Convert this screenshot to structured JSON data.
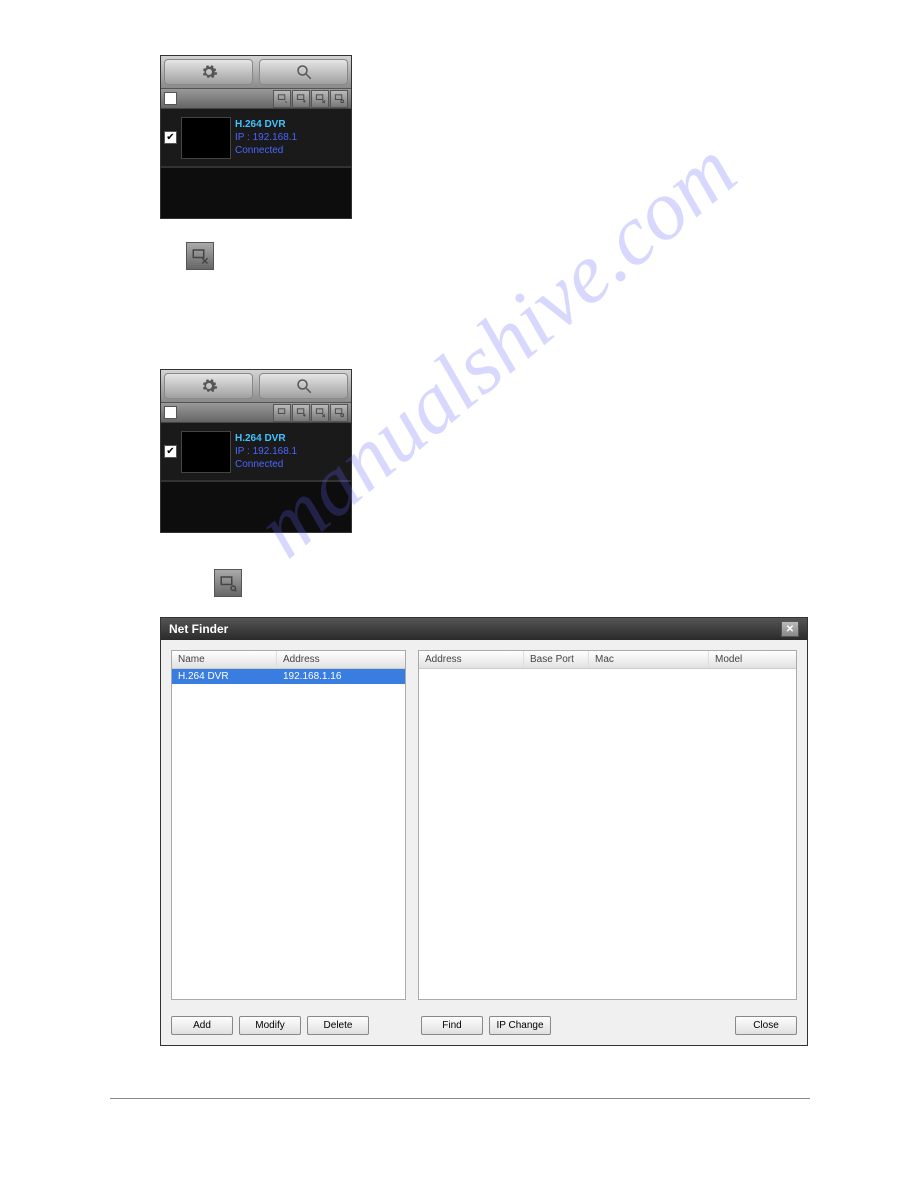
{
  "watermark": "manualshive.com",
  "device_panel": {
    "device_name": "H.264 DVR",
    "device_ip": "IP : 192.168.1",
    "device_status": "Connected"
  },
  "netfinder": {
    "title": "Net Finder",
    "left_headers": [
      "Name",
      "Address"
    ],
    "left_row": {
      "name": "H.264 DVR",
      "address": "192.168.1.16"
    },
    "right_headers": [
      "Address",
      "Base Port",
      "Mac",
      "Model"
    ],
    "buttons": {
      "add": "Add",
      "modify": "Modify",
      "delete": "Delete",
      "find": "Find",
      "ip_change": "IP Change",
      "close": "Close"
    }
  }
}
